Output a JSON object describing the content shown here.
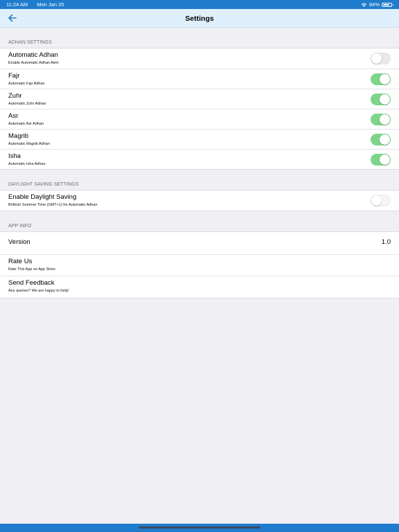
{
  "status_bar": {
    "time": "11:24 AM",
    "date": "Mon Jan 20",
    "battery_percent": "84%",
    "battery_level": 0.84,
    "wifi_icon": "wifi-icon",
    "battery_icon": "battery-icon"
  },
  "nav": {
    "title": "Settings",
    "back_icon": "back-arrow-icon"
  },
  "adhan_settings": {
    "header": "ADHAN SETTINGS",
    "rows": [
      {
        "title": "Automatic Adhan",
        "subtitle": "Enable Automatic Adhan Alert",
        "enabled": false
      },
      {
        "title": "Fajr",
        "subtitle": "Automatic Fajr Adhan",
        "enabled": true
      },
      {
        "title": "Zuhr",
        "subtitle": "Automatic Zuhr Adhan",
        "enabled": true
      },
      {
        "title": "Asr",
        "subtitle": "Automatic Asr Adhan",
        "enabled": true
      },
      {
        "title": "Magrib",
        "subtitle": "Automatic Magrib Adhan",
        "enabled": true
      },
      {
        "title": "Isha",
        "subtitle": "Automatic Isha Adhan",
        "enabled": true
      }
    ]
  },
  "daylight_settings": {
    "header": "DAYLIGHT SAVING SETTINGS",
    "rows": [
      {
        "title": "Enable Daylight Saving",
        "subtitle": "Brithish Summer Time (GMT+1) for Automatic Adhan",
        "enabled": false
      }
    ]
  },
  "app_info": {
    "header": "APP INFO",
    "version_label": "Version",
    "version_value": "1.0",
    "rate_title": "Rate Us",
    "rate_subtitle": "Rate This App on App Store",
    "feedback_title": "Send Feedback",
    "feedback_subtitle": "Any queries? We are happy to help!"
  },
  "colors": {
    "status_bar": "#1f7ccc",
    "nav_bar": "#dff0fc",
    "back_icon": "#1f7ccc",
    "toggle_on": "#7dd58a",
    "toggle_off": "#e9e9eb",
    "background": "#efeff4"
  }
}
